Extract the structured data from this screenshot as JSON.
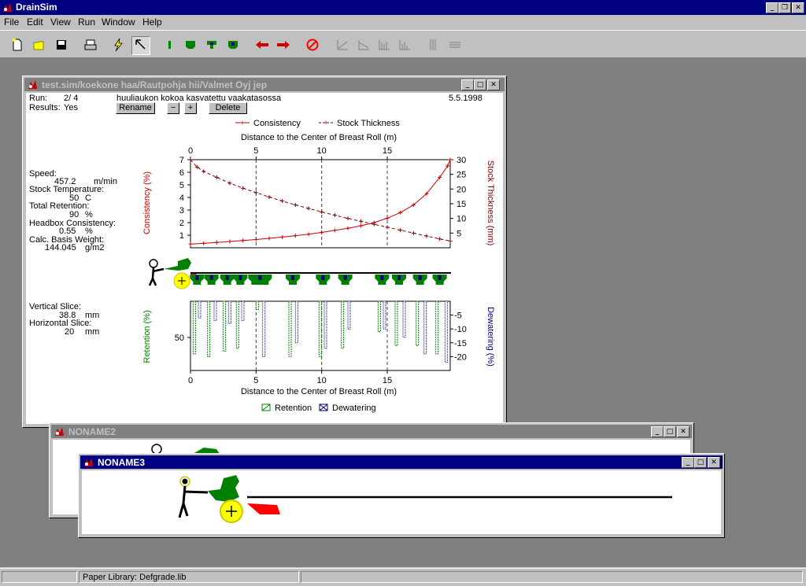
{
  "app": {
    "title": "DrainSim"
  },
  "menu": [
    "File",
    "Edit",
    "View",
    "Run",
    "Window",
    "Help"
  ],
  "toolbar": {
    "icons": [
      "new-file-icon",
      "open-folder-icon",
      "save-disk-icon",
      "print-icon",
      "run-lightning-icon",
      "pointer-tool-icon",
      "drain-element-1-icon",
      "drain-element-2-icon",
      "drain-element-3-icon",
      "drain-element-4-icon",
      "arrow-left-icon",
      "arrow-right-icon",
      "stop-icon",
      "chart-line-icon",
      "chart-area-icon",
      "chart-bar-1-icon",
      "chart-bar-2-icon",
      "vertical-lines-icon",
      "horizontal-lines-icon"
    ]
  },
  "sim_window": {
    "title": "test.sim/koekone haa/Rautpohja hii/Valmet Oyj jep",
    "run_label": "Run:",
    "run_value": "2/ 4",
    "results_label": "Results:",
    "results_value": "Yes",
    "description": "huuliaukon kokoa kasvatettu vaakatasossa",
    "date": "5.5.1998",
    "rename_button": "Rename",
    "minus_button": "−",
    "plus_button": "+",
    "delete_button": "Delete",
    "params": {
      "speed_label": "Speed:",
      "speed_value": "457.2",
      "speed_unit": "m/min",
      "temp_label": "Stock Temperature:",
      "temp_value": "50",
      "temp_unit": "C",
      "retention_label": "Total Retention:",
      "retention_value": "90",
      "retention_unit": "%",
      "headbox_label": "Headbox Consistency:",
      "headbox_value": "0.55",
      "headbox_unit": "%",
      "basis_label": "Calc. Basis Weight:",
      "basis_value": "144.045",
      "basis_unit": "g/m2"
    },
    "slices": {
      "vertical_label": "Vertical Slice:",
      "vertical_value": "38.8",
      "vertical_unit": "mm",
      "horizontal_label": "Horizontal Slice:",
      "horizontal_value": "20",
      "horizontal_unit": "mm"
    }
  },
  "chart_data": [
    {
      "type": "line",
      "title": "",
      "legend": [
        "Consistency",
        "Stock Thickness"
      ],
      "legend_placement": "top",
      "xlabel": "Distance to the Center of Breast Roll (m)",
      "xlim": [
        0,
        19.8
      ],
      "x_ticks": [
        0,
        5,
        10,
        15
      ],
      "ylabel_left": "Consistency (%)",
      "ylim_left": [
        0,
        7
      ],
      "y_ticks_left": [
        1,
        2,
        3,
        4,
        5,
        6,
        7
      ],
      "ylabel_right": "Stock Thickness (mm)",
      "ylim_right": [
        0,
        30
      ],
      "y_ticks_right": [
        5,
        10,
        15,
        20,
        25,
        30
      ],
      "grid": "dashed vertical at 5, 10, 15",
      "series": [
        {
          "name": "Consistency",
          "axis": "left",
          "color": "#cc0000",
          "x": [
            0,
            1,
            2,
            3,
            4,
            5,
            6,
            7,
            8,
            9,
            10,
            11,
            12,
            13,
            14,
            15,
            16,
            17,
            18,
            19,
            19.6,
            19.8
          ],
          "y": [
            0.3,
            0.35,
            0.42,
            0.5,
            0.58,
            0.66,
            0.75,
            0.85,
            0.96,
            1.08,
            1.22,
            1.38,
            1.55,
            1.75,
            2.0,
            2.35,
            2.8,
            3.4,
            4.3,
            5.6,
            6.5,
            7.0
          ]
        },
        {
          "name": "Stock Thickness",
          "axis": "right",
          "color": "#800000",
          "x": [
            0,
            0.5,
            1,
            2,
            3,
            4,
            5,
            6,
            7,
            8,
            9,
            10,
            11,
            12,
            13,
            14,
            15,
            16,
            17,
            18,
            19,
            19.8
          ],
          "y": [
            30,
            27.5,
            26,
            24,
            22,
            20.3,
            18.8,
            17.3,
            15.9,
            14.6,
            13.4,
            12.2,
            11.1,
            10.0,
            9.0,
            8.0,
            7.0,
            6.0,
            5.0,
            4.0,
            3.0,
            2.3
          ]
        }
      ]
    },
    {
      "type": "bar",
      "title": "",
      "legend": [
        "Retention",
        "Dewatering"
      ],
      "legend_placement": "bottom",
      "xlabel": "Distance to the Center of Breast Roll (m)",
      "xlim": [
        0,
        19.8
      ],
      "x_ticks": [
        0,
        5,
        10,
        15
      ],
      "ylabel_left": "Retention (%)",
      "y_ticks_left": [
        50
      ],
      "ylabel_right": "Dewatering (%)",
      "ylim_right": [
        0,
        25
      ],
      "y_ticks_right": [
        5,
        10,
        15,
        20
      ],
      "grid": "dashed vertical at 5, 10, 15",
      "series": [
        {
          "name": "Retention",
          "color": "#008000",
          "x": [
            0.2,
            1.3,
            2.5,
            3.5,
            5.0,
            7.5,
            9.8,
            11.5,
            14.3,
            15.6,
            17.2,
            18.7
          ],
          "values": [
            19,
            20,
            18,
            17,
            3,
            20,
            20,
            17,
            11,
            16,
            16,
            19
          ]
        },
        {
          "name": "Dewatering",
          "color": "#000080",
          "x": [
            0.6,
            1.8,
            2.9,
            3.9,
            5.5,
            8.0,
            10.2,
            12.0,
            14.7,
            16.2,
            17.8,
            19.4
          ],
          "values": [
            6,
            7,
            8,
            7,
            20,
            15,
            17,
            10,
            10,
            13,
            19,
            22
          ]
        }
      ]
    }
  ],
  "noname2": {
    "title": "NONAME2"
  },
  "noname3": {
    "title": "NONAME3"
  },
  "status": {
    "panel1": "",
    "panel2": "Paper Library: Defgrade.lib",
    "panel3": ""
  },
  "colors": {
    "title_active": "#000080",
    "title_inactive": "#808080",
    "consistency": "#cc0000",
    "thickness": "#800000",
    "retention": "#008000",
    "dewatering": "#000080",
    "machine_green": "#008000",
    "headbox_red": "#ff0000"
  }
}
